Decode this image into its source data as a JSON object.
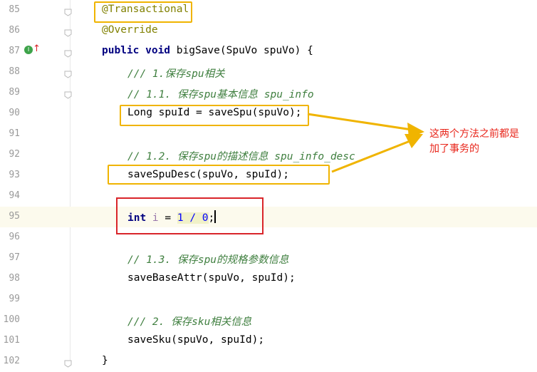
{
  "lines": [
    {
      "num": "85",
      "parts": [
        {
          "t": "@Transactional",
          "c": "ann"
        }
      ]
    },
    {
      "num": "86",
      "parts": [
        {
          "t": "@Override",
          "c": "ann"
        }
      ]
    },
    {
      "num": "87",
      "parts": [
        {
          "t": "public void ",
          "c": "kw"
        },
        {
          "t": "bigSave(SpuVo spuVo) {",
          "c": ""
        }
      ]
    },
    {
      "num": "88",
      "parts": [
        {
          "t": "/// 1.保存spu相关",
          "c": "cmtg"
        }
      ]
    },
    {
      "num": "89",
      "parts": [
        {
          "t": "// 1.1. 保存spu基本信息 spu_info",
          "c": "cmtg"
        }
      ]
    },
    {
      "num": "90",
      "parts": [
        {
          "t": "Long spuId = saveSpu(spuVo);",
          "c": ""
        }
      ]
    },
    {
      "num": "91",
      "parts": []
    },
    {
      "num": "92",
      "parts": [
        {
          "t": "// 1.2. 保存spu的描述信息 spu_info_desc",
          "c": "cmtg"
        }
      ]
    },
    {
      "num": "93",
      "parts": [
        {
          "t": "saveSpuDesc(spuVo, spuId);",
          "c": ""
        }
      ]
    },
    {
      "num": "94",
      "parts": []
    },
    {
      "num": "95",
      "parts": [
        {
          "t": "int ",
          "c": "kw"
        },
        {
          "t": "i",
          "c": "var"
        },
        {
          "t": " = ",
          "c": ""
        },
        {
          "t": "1 / 0",
          "c": "num"
        },
        {
          "t": ";",
          "c": ""
        }
      ]
    },
    {
      "num": "96",
      "parts": []
    },
    {
      "num": "97",
      "parts": [
        {
          "t": "// 1.3. 保存spu的规格参数信息",
          "c": "cmtg"
        }
      ]
    },
    {
      "num": "98",
      "parts": [
        {
          "t": "saveBaseAttr(spuVo, spuId);",
          "c": ""
        }
      ]
    },
    {
      "num": "99",
      "parts": []
    },
    {
      "num": "100",
      "parts": [
        {
          "t": "/// 2. 保存sku相关信息",
          "c": "cmtg"
        }
      ]
    },
    {
      "num": "101",
      "parts": [
        {
          "t": "saveSku(spuVo, spuId);",
          "c": ""
        }
      ]
    },
    {
      "num": "102",
      "parts": [
        {
          "t": "}",
          "c": ""
        }
      ]
    }
  ],
  "annotation": {
    "text_line1": "这两个方法之前都是",
    "text_line2": "加了事务的"
  },
  "colors": {
    "highlight_box": "#f0b400",
    "error_box": "#d9252a",
    "note_text": "#e8261b",
    "arrow": "#f0b400"
  }
}
